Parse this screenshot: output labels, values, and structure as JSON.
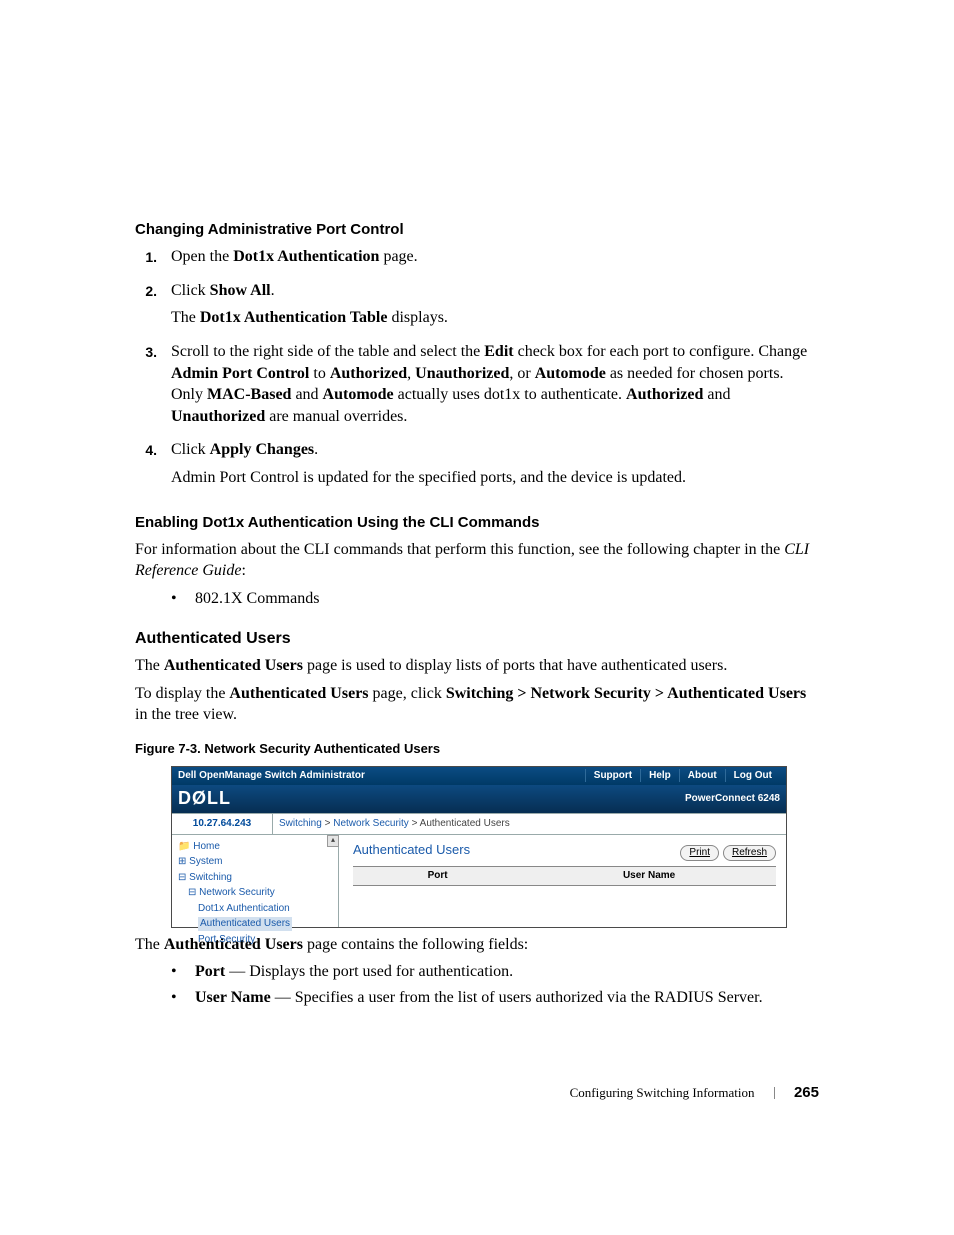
{
  "heading1": "Changing Administrative Port Control",
  "steps1": {
    "n1": "1.",
    "s1a": "Open the ",
    "s1b": "Dot1x Authentication",
    "s1c": " page.",
    "n2": "2.",
    "s2a": "Click ",
    "s2b": "Show All",
    "s2c": ".",
    "s2d": "The ",
    "s2e": "Dot1x Authentication Table",
    "s2f": " displays.",
    "n3": "3.",
    "s3a": "Scroll to the right side of the table and select the ",
    "s3b": "Edit",
    "s3c": " check box for each port to configure. Change ",
    "s3d": "Admin Port Control",
    "s3e": " to ",
    "s3f": "Authorized",
    "s3g": ", ",
    "s3h": "Unauthorized",
    "s3i": ", or ",
    "s3j": "Automode",
    "s3k": " as needed for chosen ports. Only ",
    "s3l": "MAC-Based",
    "s3m": " and ",
    "s3n": "Automode",
    "s3o": " actually uses dot1x to authenticate. ",
    "s3p": "Authorized",
    "s3q": " and ",
    "s3r": "Unauthorized",
    "s3s": " are manual overrides.",
    "n4": "4.",
    "s4a": "Click ",
    "s4b": "Apply Changes",
    "s4c": ".",
    "s4d": "Admin Port Control is updated for the specified ports, and the device is updated."
  },
  "heading2": "Enabling Dot1x Authentication Using the CLI Commands",
  "cli_intro_a": "For information about the CLI commands that perform this function, see the following chapter in the ",
  "cli_intro_b": "CLI Reference Guide",
  "cli_intro_c": ":",
  "cli_bullet": "802.1X Commands",
  "heading3": "Authenticated Users",
  "au_p1a": "The ",
  "au_p1b": "Authenticated Users",
  "au_p1c": " page is used to display lists of ports that have authenticated users.",
  "au_p2a": "To display the ",
  "au_p2b": "Authenticated Users",
  "au_p2c": " page, click ",
  "au_p2d": "Switching > Network Security > Authenticated Users",
  "au_p2e": " in the tree view.",
  "fig_caption": "Figure 7-3.    Network Security Authenticated Users",
  "shot": {
    "title": "Dell OpenManage Switch Administrator",
    "nav": {
      "support": "Support",
      "help": "Help",
      "about": "About",
      "logout": "Log Out"
    },
    "logo": "DØLL",
    "model": "PowerConnect 6248",
    "ip": "10.27.64.243",
    "crumb1": "Switching",
    "crumb2": "Network Security",
    "crumb3": "Authenticated Users",
    "tree": {
      "home": "Home",
      "system": "System",
      "switching": "Switching",
      "netsec": "Network Security",
      "dot1x": "Dot1x Authentication",
      "auth": "Authenticated Users",
      "portsec": "Port Security"
    },
    "content_title": "Authenticated Users",
    "btn_print": "Print",
    "btn_refresh": "Refresh",
    "col_port": "Port",
    "col_user": "User Name"
  },
  "after_fig_a": "The ",
  "after_fig_b": "Authenticated Users",
  "after_fig_c": " page contains the following fields:",
  "field_port_a": "Port",
  "field_port_b": " — Displays the port used for authentication.",
  "field_user_a": "User Name",
  "field_user_b": " — Specifies a user from the list of users authorized via the RADIUS Server.",
  "footer_section": "Configuring Switching Information",
  "footer_page": "265"
}
